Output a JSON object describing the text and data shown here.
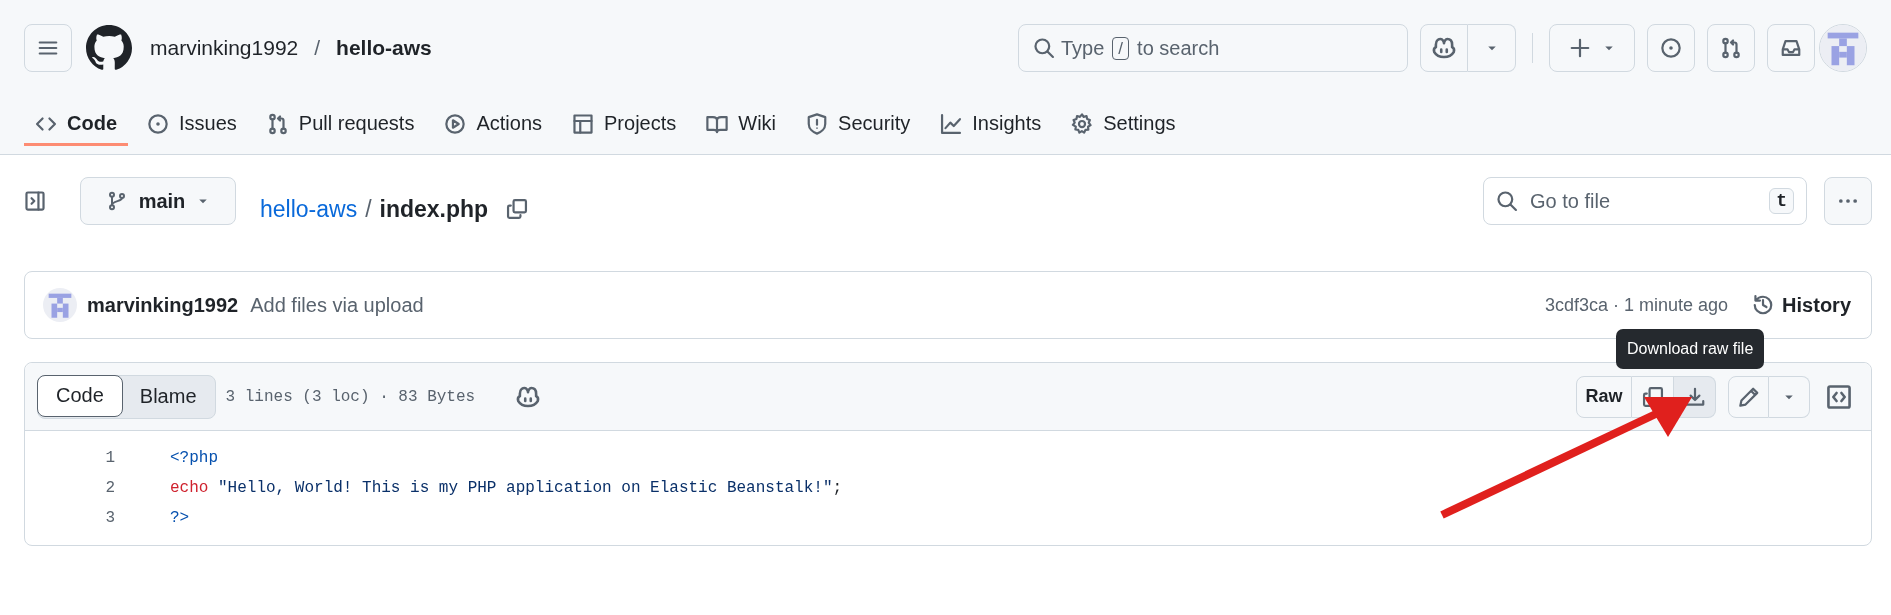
{
  "header": {
    "owner": "marvinking1992",
    "separator": "/",
    "repo": "hello-aws",
    "search": {
      "before": "Type",
      "key": "/",
      "after": "to search"
    }
  },
  "tabs": [
    {
      "label": "Code",
      "selected": true
    },
    {
      "label": "Issues",
      "selected": false
    },
    {
      "label": "Pull requests",
      "selected": false
    },
    {
      "label": "Actions",
      "selected": false
    },
    {
      "label": "Projects",
      "selected": false
    },
    {
      "label": "Wiki",
      "selected": false
    },
    {
      "label": "Security",
      "selected": false
    },
    {
      "label": "Insights",
      "selected": false
    },
    {
      "label": "Settings",
      "selected": false
    }
  ],
  "file_bar": {
    "branch": "main",
    "repo": "hello-aws",
    "separator": "/",
    "file": "index.php",
    "go_to_file": {
      "placeholder": "Go to file",
      "shortcut": "t"
    }
  },
  "commit": {
    "author": "marvinking1992",
    "message": "Add files via upload",
    "meta": "3cdf3ca · 1 minute ago",
    "history": "History"
  },
  "file_view": {
    "view_tabs": [
      {
        "label": "Code",
        "selected": true
      },
      {
        "label": "Blame",
        "selected": false
      }
    ],
    "info": "3 lines (3 loc) · 83 Bytes",
    "raw": "Raw",
    "tooltip": "Download raw file",
    "lines": [
      {
        "number": "1",
        "tokens": [
          {
            "kind": "tag",
            "text": "<?php"
          }
        ]
      },
      {
        "number": "2",
        "tokens": [
          {
            "kind": "keyword",
            "text": "echo"
          },
          {
            "kind": "string",
            "text": " \"Hello, World! This is my PHP application on Elastic Beanstalk!\""
          },
          {
            "kind": "plain",
            "text": ";"
          }
        ]
      },
      {
        "number": "3",
        "tokens": [
          {
            "kind": "tag",
            "text": "?>"
          }
        ]
      }
    ]
  }
}
